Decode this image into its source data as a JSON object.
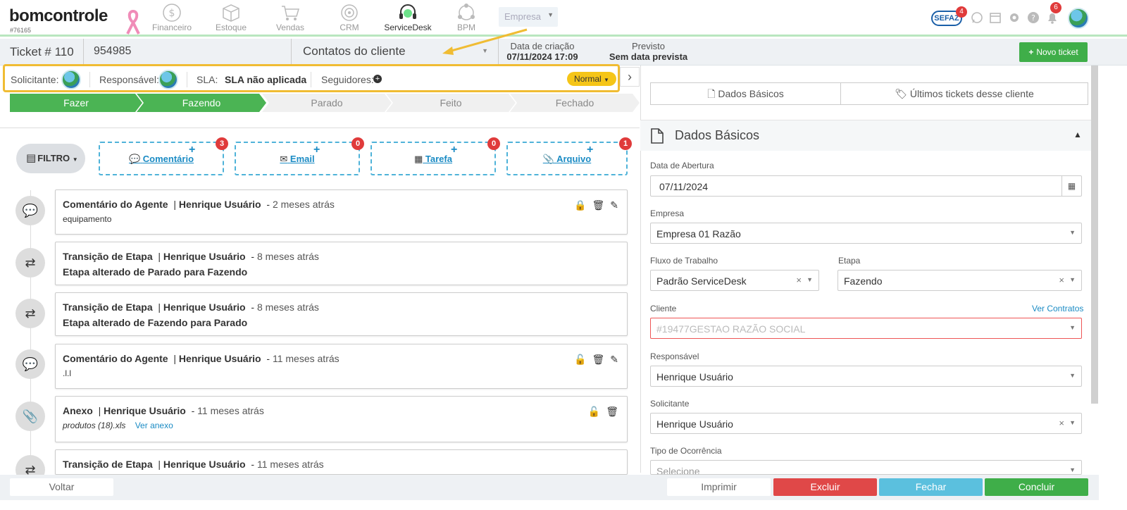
{
  "nav": {
    "logo": "bomcontrole",
    "account_id": "#76165",
    "items": [
      {
        "label": "Financeiro",
        "icon": "dollar-icon"
      },
      {
        "label": "Estoque",
        "icon": "box-icon"
      },
      {
        "label": "Vendas",
        "icon": "cart-icon"
      },
      {
        "label": "CRM",
        "icon": "target-icon"
      },
      {
        "label": "ServiceDesk",
        "icon": "headset-icon"
      },
      {
        "label": "BPM",
        "icon": "network-icon"
      }
    ],
    "empresa_select": "Empresa",
    "sefaz": "SEFAZ",
    "sefaz_badge": "4",
    "notif_badge": "6"
  },
  "ticket": {
    "title": "Ticket # 110",
    "number": "954985",
    "contact_placeholder": "Contatos do cliente",
    "created_label": "Data de criação",
    "created_value": "07/11/2024 17:09",
    "prev_label": "Previsto",
    "prev_value": "Sem data prevista",
    "novo_ticket": "Novo ticket"
  },
  "info": {
    "solicitante": "Solicitante:",
    "responsavel": "Responsável:",
    "sla_label": "SLA:",
    "sla_value": "SLA não aplicada",
    "seguidores": "Seguidores:",
    "priority": "Normal"
  },
  "stages": [
    "Fazer",
    "Fazendo",
    "Parado",
    "Feito",
    "Fechado"
  ],
  "actions": {
    "filtro": "FILTRO",
    "items": [
      {
        "label": "Comentário",
        "count": "3"
      },
      {
        "label": "Email",
        "count": "0"
      },
      {
        "label": "Tarefa",
        "count": "0"
      },
      {
        "label": "Arquivo",
        "count": "1"
      }
    ]
  },
  "timeline": [
    {
      "type": "Comentário do Agente",
      "user": "Henrique Usuário",
      "time": "2 meses atrás",
      "body": "equipamento"
    },
    {
      "type": "Transição de Etapa",
      "user": "Henrique Usuário",
      "time": "8 meses atrás",
      "body": "Etapa alterado de Parado para Fazendo"
    },
    {
      "type": "Transição de Etapa",
      "user": "Henrique Usuário",
      "time": "8 meses atrás",
      "body": "Etapa alterado de Fazendo para Parado"
    },
    {
      "type": "Comentário do Agente",
      "user": "Henrique Usuário",
      "time": "11 meses atrás",
      "body": ".l.l"
    },
    {
      "type": "Anexo",
      "user": "Henrique Usuário",
      "time": "11 meses atrás",
      "body": "produtos (18).xls",
      "link": "Ver anexo"
    },
    {
      "type": "Transição de Etapa",
      "user": "Henrique Usuário",
      "time": "11 meses atrás",
      "body": ""
    }
  ],
  "right": {
    "tab1": "Dados Básicos",
    "tab2": "Últimos tickets desse cliente",
    "panel_title": "Dados Básicos",
    "data_abertura_label": "Data de Abertura",
    "data_abertura": "07/11/2024",
    "empresa_label": "Empresa",
    "empresa": "Empresa 01 Razão",
    "fluxo_label": "Fluxo de Trabalho",
    "fluxo": "Padrão ServiceDesk",
    "etapa_label": "Etapa",
    "etapa": "Fazendo",
    "cliente_label": "Cliente",
    "ver_contratos": "Ver Contratos",
    "cliente": "#19477GESTAO RAZÃO SOCIAL",
    "responsavel_label": "Responsável",
    "responsavel": "Henrique Usuário",
    "solicitante_label": "Solicitante",
    "solicitante": "Henrique Usuário",
    "ocorrencia_label": "Tipo de Ocorrência",
    "ocorrencia_placeholder": "Selecione"
  },
  "bottom": {
    "voltar": "Voltar",
    "imprimir": "Imprimir",
    "excluir": "Excluir",
    "fechar": "Fechar",
    "concluir": "Concluir"
  },
  "colors": {
    "green": "#3fae49",
    "red": "#e04848",
    "blue": "#5bc0de",
    "highlight": "#f0bc33"
  }
}
